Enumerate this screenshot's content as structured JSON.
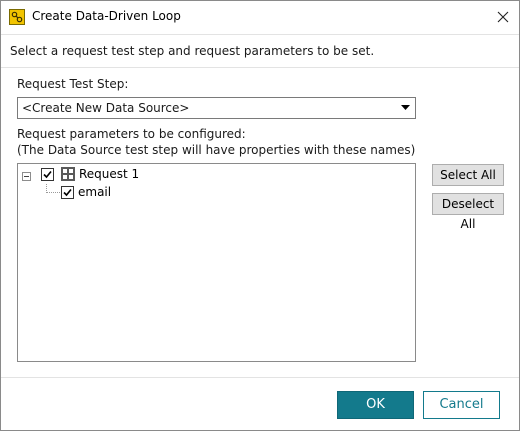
{
  "window": {
    "title": "Create Data-Driven Loop",
    "app_icon": "soapui-app-icon",
    "close_icon": "close-icon"
  },
  "banner": {
    "text": "Select a request test step and request parameters to be set."
  },
  "request_test_step": {
    "label": "Request Test Step:",
    "selected_value": "<Create New Data Source>"
  },
  "parameters": {
    "label_line1": "Request parameters to be configured:",
    "label_line2": "(The Data Source test step will have properties with these names)",
    "tree": [
      {
        "label": "Request 1",
        "checked": true,
        "expanded": true,
        "icon": "request-icon",
        "children": [
          {
            "label": "email",
            "checked": true
          }
        ]
      }
    ]
  },
  "side_buttons": {
    "select_all": "Select All",
    "deselect_all": "Deselect All"
  },
  "footer": {
    "ok": "OK",
    "cancel": "Cancel"
  },
  "colors": {
    "accent": "#137a8c",
    "app_icon_bg": "#f2c400"
  }
}
